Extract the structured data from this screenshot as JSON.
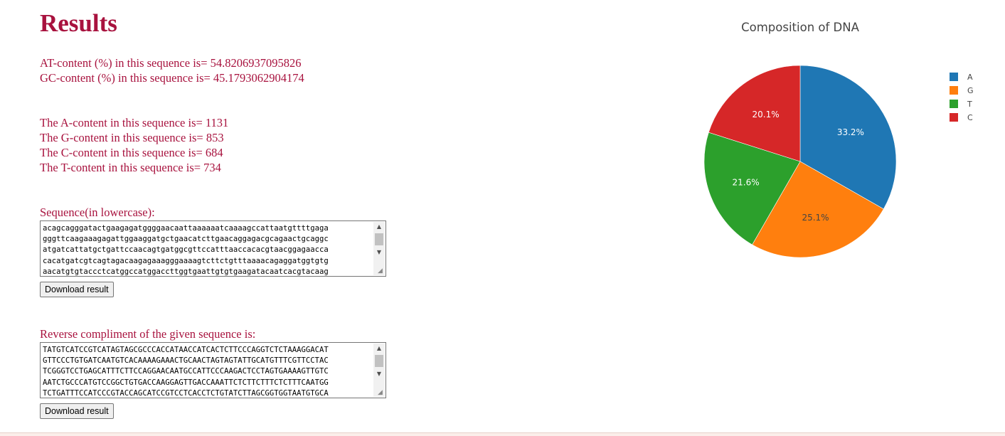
{
  "results": {
    "title": "Results",
    "at_content_text": "AT-content (%) in this sequence is= 54.8206937095826",
    "gc_content_text": "GC-content (%) in this sequence is= 45.1793062904174",
    "a_content_text": "The A-content in this sequence is= 1131",
    "g_content_text": "The G-content in this sequence is= 853",
    "c_content_text": "The C-content in this sequence is= 684",
    "t_content_text": "The T-content in this sequence is= 734"
  },
  "sequence": {
    "label": "Sequence(in lowercase):",
    "value": "acagcagggatactgaagagatggggaacaattaaaaaatcaaaagccattaatgttttgaga\ngggttcaagaaagagattggaaggatgctgaacatcttgaacaggagacgcagaactgcaggc\natgatcattatgctgattccaacagtgatggcgttccatttaaccacacgtaacggagaacca\ncacatgatcgtcagtagacaagagaaagggaaaagtcttctgtttaaaacagaggatggtgtg\naacatgtgtaccctcatggccatggaccttggtgaattgtgtgaagatacaatcacgtacaag",
    "download_label": "Download result"
  },
  "reverse_complement": {
    "label": "Reverse compliment of the given sequence is:",
    "value": "TATGTCATCCGTCATAGTAGCGCCCACCATAACCATCACTCTTCCCAGGTCTCTAAAGGACAT\nGTTCCCTGTGATCAATGTCACAAAAGAAACTGCAACTAGTAGTATTGCATGTTTCGTTCCTAC\nTCGGGTCCTGAGCATTTCTTCCAGGAACAATGCCATTCCCAAGACTCCTAGTGAAAAGTTGTC\nAATCTGCCCATGTCCGGCTGTGACCAAGGAGTTGACCAAATTCTCTTCTTTCTCTTTCAATGG\nTCTGATTTCCATCCCGTACCAGCATCCGTCCTCACCTCTGTATCTTAGCGGTGGTAATGTGCA",
    "download_label": "Download result"
  },
  "icons": {
    "scroll_up": "scroll-up-arrow-icon",
    "scroll_down": "scroll-down-arrow-icon",
    "resize": "resize-grip-icon"
  },
  "chart_data": {
    "type": "pie",
    "title": "Composition of DNA",
    "categories": [
      "A",
      "G",
      "T",
      "C"
    ],
    "values": [
      1131,
      853,
      734,
      684
    ],
    "percent_labels": [
      "33.2%",
      "25.1%",
      "21.6%",
      "20.1%"
    ],
    "colors": [
      "#1f77b4",
      "#ff7f0e",
      "#2ca02c",
      "#d62728"
    ],
    "label_colors": [
      "#ffffff",
      "#444444",
      "#ffffff",
      "#ffffff"
    ],
    "legend_position": "top-right"
  }
}
